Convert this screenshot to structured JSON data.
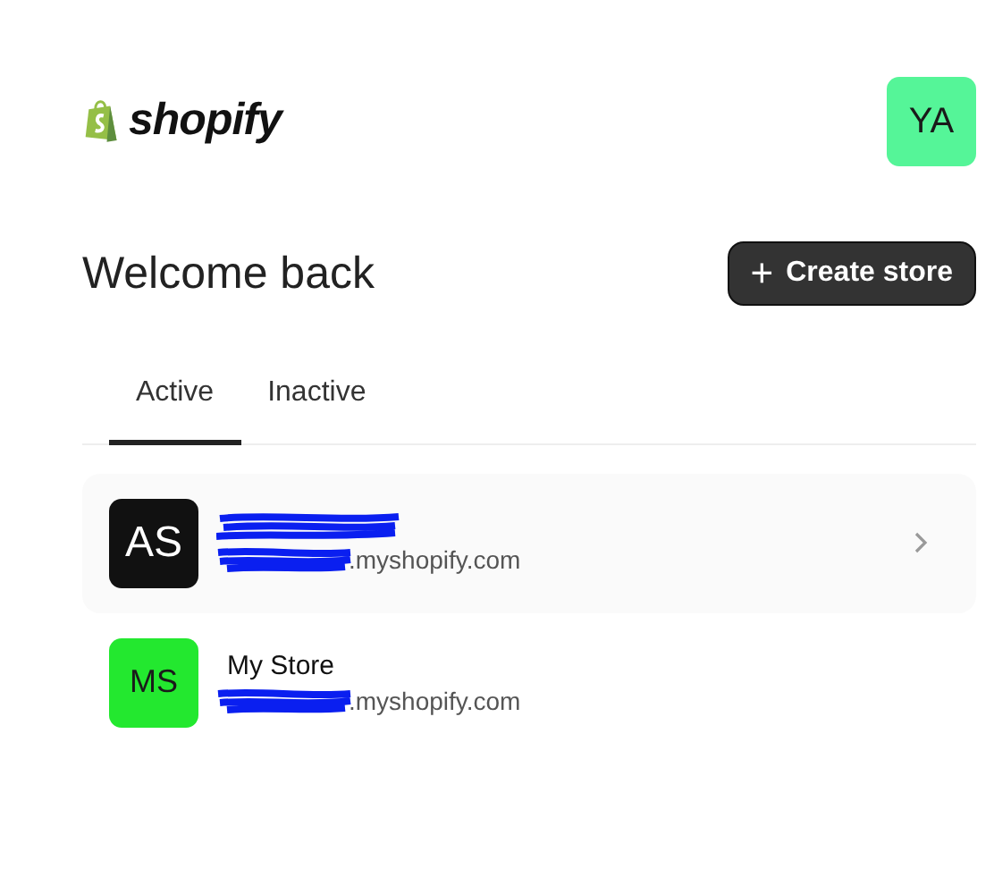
{
  "header": {
    "logo_text": "shopify",
    "avatar": {
      "initials": "YA",
      "color": "#55f598"
    }
  },
  "heading": "Welcome back",
  "create_button": {
    "icon": "+",
    "label": "Create store"
  },
  "tabs": [
    {
      "label": "Active",
      "selected": true
    },
    {
      "label": "Inactive",
      "selected": false
    }
  ],
  "stores": [
    {
      "initials": "AS",
      "color": "#111111",
      "domain": ".myshopify.com",
      "highlighted": true
    },
    {
      "initials": "MS",
      "color": "#23e82f",
      "name": "My Store",
      "domain": ".myshopify.com",
      "highlighted": false
    }
  ]
}
